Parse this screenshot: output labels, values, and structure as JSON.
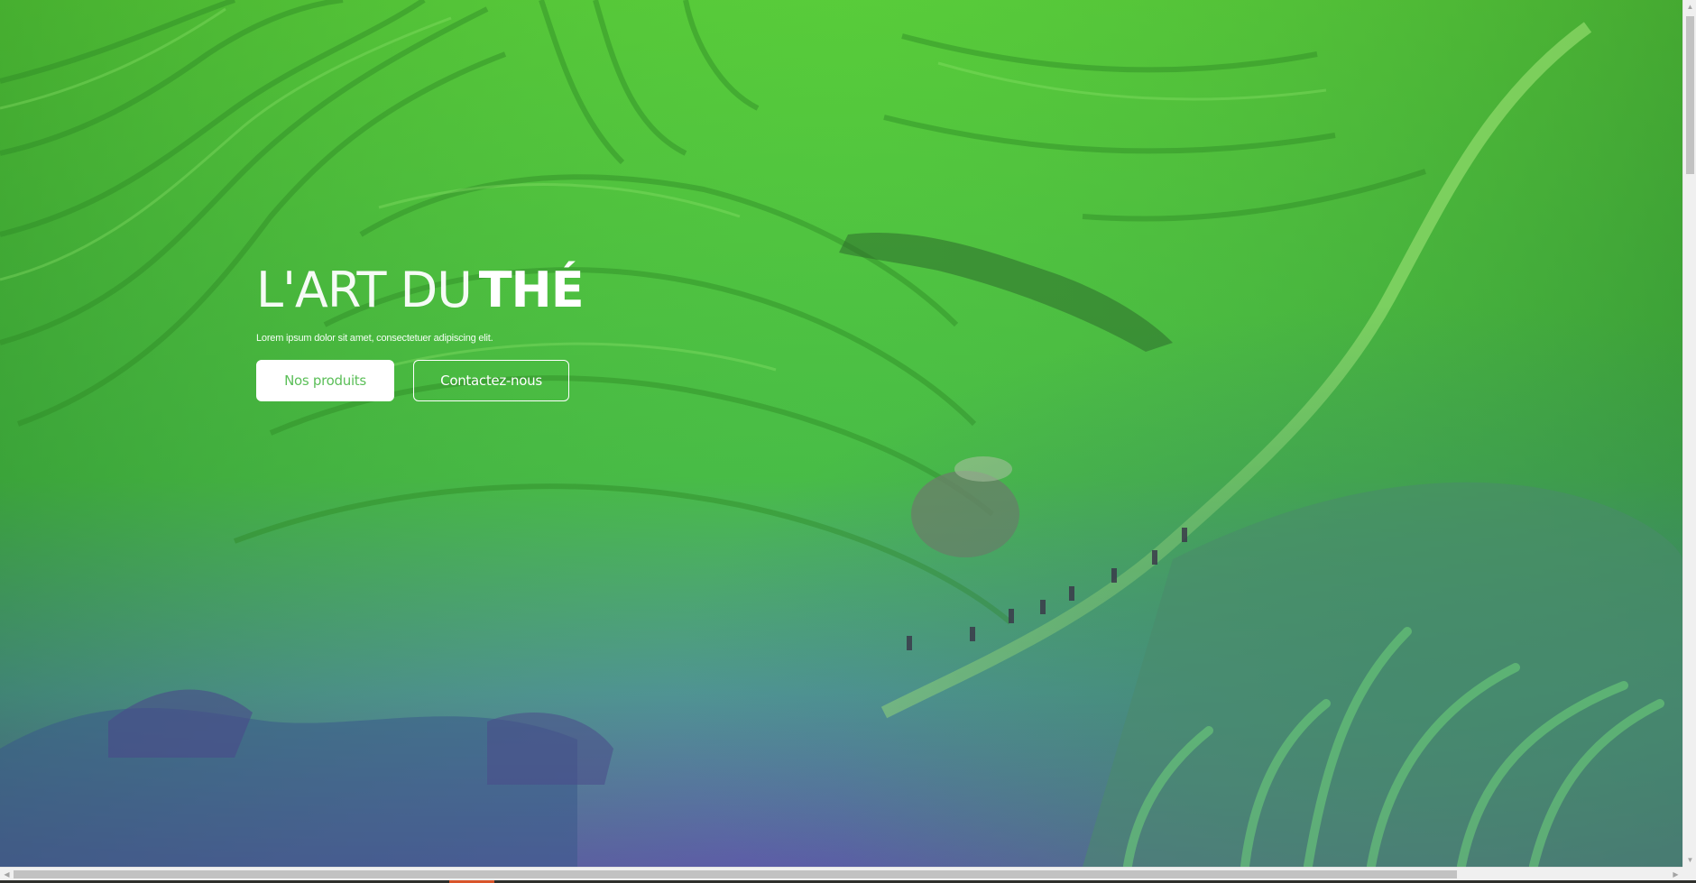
{
  "hero": {
    "title_light": "L'ART DU",
    "title_bold": "THÉ",
    "subtitle": "Lorem ipsum dolor sit amet, consectetuer adipiscing elit.",
    "primary_button": "Nos produits",
    "secondary_button": "Contactez-nous"
  },
  "background": {
    "description_icon": "rice-terraces-image",
    "overlay_top_color": "#4fd63e",
    "overlay_bottom_color": "#5a4fb8"
  },
  "colors": {
    "accent": "#5cbf59",
    "text_on_hero": "#ffffff"
  }
}
